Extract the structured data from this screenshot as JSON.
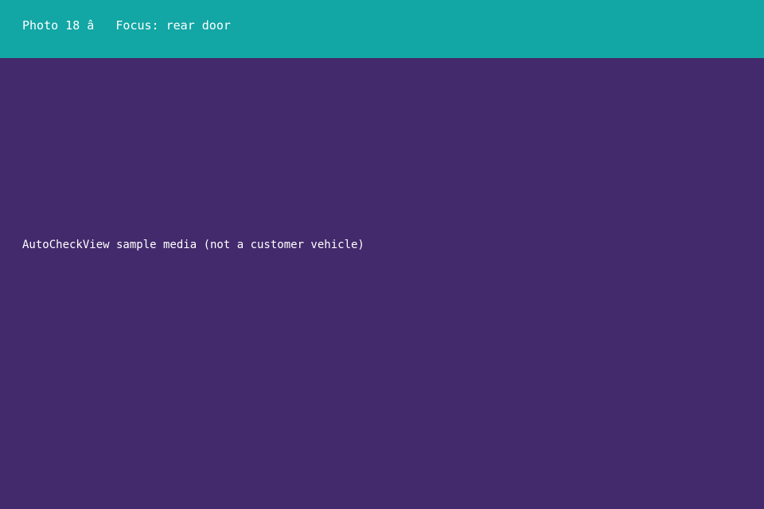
{
  "header": {
    "title": "Photo 18 â   Focus: rear door"
  },
  "media": {
    "caption": "AutoCheckView sample media (not a customer vehicle)"
  },
  "colors": {
    "header_background": "#12a6a5",
    "media_background": "#432a6c",
    "text": "#ffffff"
  }
}
